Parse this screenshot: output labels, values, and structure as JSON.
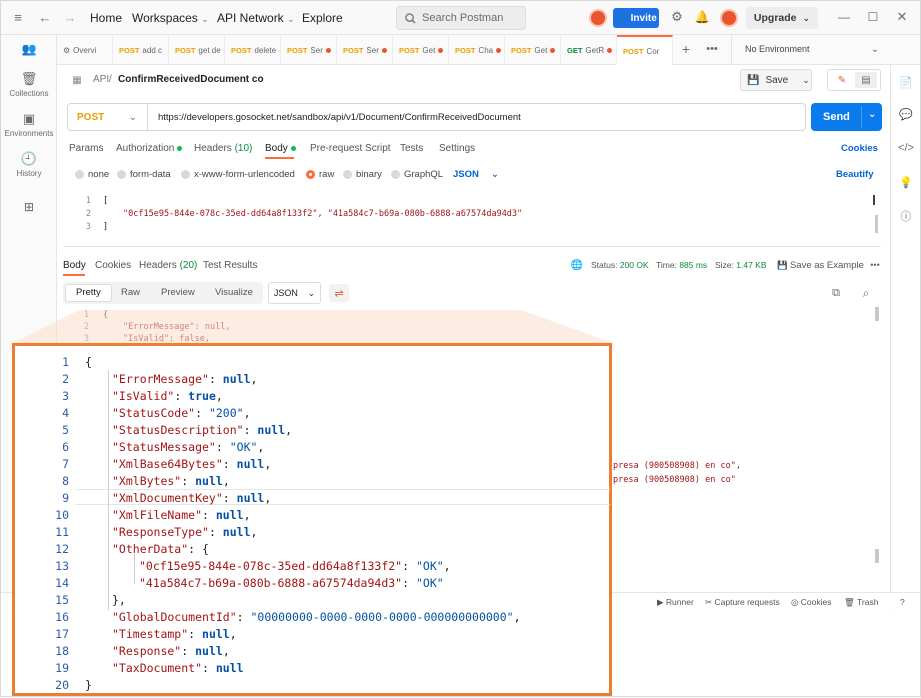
{
  "titlebar": {
    "home": "Home",
    "workspaces": "Workspaces",
    "api_network": "API Network",
    "explore": "Explore",
    "search_placeholder": "Search Postman",
    "invite": "Invite",
    "upgrade": "Upgrade"
  },
  "sidebar": {
    "items": [
      {
        "label": "Collections"
      },
      {
        "label": "Environments"
      },
      {
        "label": "History"
      }
    ]
  },
  "tabs": [
    {
      "method": "",
      "label": "Overvi"
    },
    {
      "method": "POST",
      "label": "add c"
    },
    {
      "method": "POST",
      "label": "get de"
    },
    {
      "method": "POST",
      "label": "delete"
    },
    {
      "method": "POST",
      "label": "Ser"
    },
    {
      "method": "POST",
      "label": "Ser"
    },
    {
      "method": "POST",
      "label": "Get"
    },
    {
      "method": "POST",
      "label": "Cha"
    },
    {
      "method": "POST",
      "label": "Get"
    },
    {
      "method": "GET",
      "label": "GetR"
    },
    {
      "method": "POST",
      "label": "Cor"
    }
  ],
  "environment": "No Environment",
  "breadcrumb": {
    "root": "API",
    "sep": "/",
    "name": "ConfirmReceivedDocument co"
  },
  "save_label": "Save",
  "request": {
    "method": "POST",
    "url": "https://developers.gosocket.net/sandbox/api/v1/Document/ConfirmReceivedDocument",
    "send": "Send"
  },
  "req_tabs": {
    "params": "Params",
    "authorization": "Authorization",
    "headers": "Headers",
    "headers_count": "(10)",
    "body": "Body",
    "prerequest": "Pre-request Script",
    "tests": "Tests",
    "settings": "Settings",
    "cookies": "Cookies"
  },
  "body_types": {
    "none": "none",
    "form_data": "form-data",
    "urlencoded": "x-www-form-urlencoded",
    "raw": "raw",
    "binary": "binary",
    "graphql": "GraphQL",
    "lang": "JSON",
    "beautify": "Beautify"
  },
  "request_body": {
    "lines": [
      "[",
      "\"0cf15e95-844e-078c-35ed-dd64a8f133f2\", \"41a584c7-b69a-080b-6888-a67574da94d3\"",
      "]"
    ]
  },
  "response": {
    "tabs": {
      "body": "Body",
      "cookies": "Cookies",
      "headers": "Headers",
      "headers_count": "(20)",
      "tests": "Test Results"
    },
    "status_label": "Status:",
    "status": "200 OK",
    "time_label": "Time:",
    "time": "885 ms",
    "size_label": "Size:",
    "size": "1.47 KB",
    "save_example": "Save as Example",
    "formats": {
      "pretty": "Pretty",
      "raw": "Raw",
      "preview": "Preview",
      "visualize": "Visualize"
    },
    "lang": "JSON",
    "bg_snippet": {
      "line2": "\"ErrorMessage\": null,",
      "line3": "\"IsValid\": false,",
      "right1": "presa (900508908) en co\",",
      "right2": "presa (900508908) en co\""
    }
  },
  "footer": {
    "runner": "Runner",
    "capture": "Capture requests",
    "cookies": "Cookies",
    "trash": "Trash"
  },
  "zoom_json": {
    "line_numbers": [
      "1",
      "2",
      "3",
      "4",
      "5",
      "6",
      "7",
      "8",
      "9",
      "10",
      "11",
      "12",
      "13",
      "14",
      "15",
      "16",
      "17",
      "18",
      "19",
      "20"
    ],
    "open": "{",
    "close": "}",
    "fields": [
      {
        "key": "\"ErrorMessage\"",
        "value": "null",
        "kind": "kw"
      },
      {
        "key": "\"IsValid\"",
        "value": "true",
        "kind": "kw"
      },
      {
        "key": "\"StatusCode\"",
        "value": "\"200\"",
        "kind": "str"
      },
      {
        "key": "\"StatusDescription\"",
        "value": "null",
        "kind": "kw"
      },
      {
        "key": "\"StatusMessage\"",
        "value": "\"OK\"",
        "kind": "str"
      },
      {
        "key": "\"XmlBase64Bytes\"",
        "value": "null",
        "kind": "kw"
      },
      {
        "key": "\"XmlBytes\"",
        "value": "null",
        "kind": "kw"
      },
      {
        "key": "\"XmlDocumentKey\"",
        "value": "null",
        "kind": "kw"
      },
      {
        "key": "\"XmlFileName\"",
        "value": "null",
        "kind": "kw"
      },
      {
        "key": "\"ResponseType\"",
        "value": "null",
        "kind": "kw"
      }
    ],
    "other_data_key": "\"OtherData\"",
    "other_data": [
      {
        "key": "\"0cf15e95-844e-078c-35ed-dd64a8f133f2\"",
        "value": "\"OK\""
      },
      {
        "key": "\"41a584c7-b69a-080b-6888-a67574da94d3\"",
        "value": "\"OK\""
      }
    ],
    "tail_fields": [
      {
        "key": "\"GlobalDocumentId\"",
        "value": "\"00000000-0000-0000-0000-000000000000\"",
        "kind": "str"
      },
      {
        "key": "\"Timestamp\"",
        "value": "null",
        "kind": "kw"
      },
      {
        "key": "\"Response\"",
        "value": "null",
        "kind": "kw"
      },
      {
        "key": "\"TaxDocument\"",
        "value": "null",
        "kind": "kw"
      }
    ]
  },
  "colors": {
    "accent": "#ff6c37",
    "send_blue": "#097bed",
    "invite_blue": "#1f6fe5",
    "callout_orange": "#ed7d31",
    "status_green": "#0c8b3f"
  },
  "icons": {
    "menu": "hamburger-icon",
    "back": "arrow-left-icon",
    "forward": "arrow-right-icon",
    "search": "search-icon",
    "settings": "gear-icon",
    "notifications": "bell-icon"
  }
}
